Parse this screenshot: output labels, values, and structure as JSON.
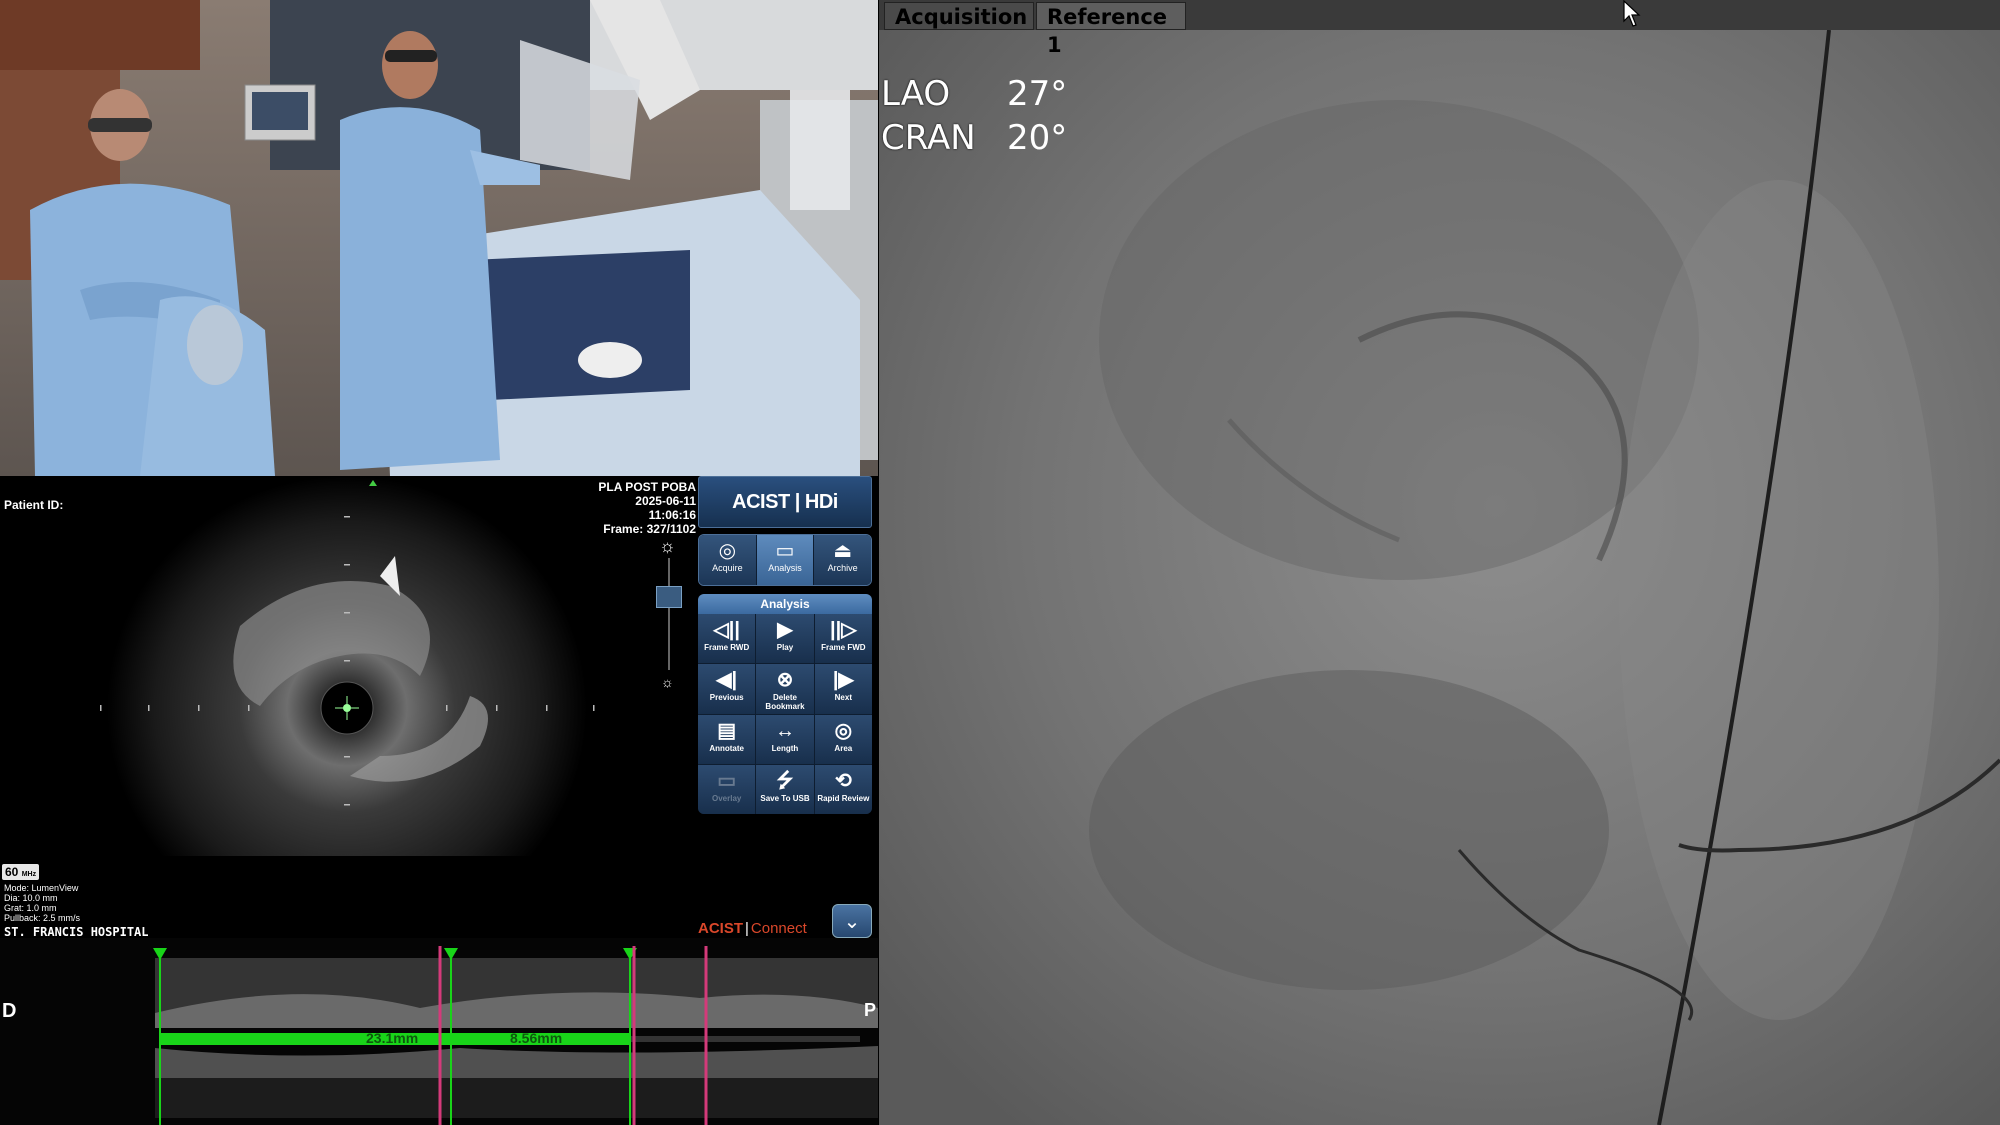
{
  "ivus": {
    "patient_label": "Patient ID:",
    "recording": {
      "name": "PLA POST POBA",
      "date": "2025-06-11",
      "time": "11:06:16",
      "frame": "Frame: 327/1102"
    },
    "frequency": "60",
    "frequency_unit": "MHz",
    "settings": {
      "mode": "Mode: LumenView",
      "dia": "Dia: 10.0 mm",
      "grat": "Grat: 1.0 mm",
      "pullback": "Pullback: 2.5 mm/s"
    },
    "hospital": "ST. FRANCIS HOSPITAL",
    "long_view": {
      "distal": "D",
      "proximal": "P",
      "measure_1": "23.1mm",
      "measure_2": "8.56mm"
    }
  },
  "panel": {
    "logo_acist": "ACIST",
    "logo_hdi": "HDi",
    "modes": [
      {
        "label": "Acquire",
        "icon": "acquire-icon"
      },
      {
        "label": "Analysis",
        "icon": "ruler-icon"
      },
      {
        "label": "Archive",
        "icon": "archive-icon"
      }
    ],
    "analysis_title": "Analysis",
    "buttons": [
      {
        "label": "Frame RWD",
        "icon": "frame-rewind-icon",
        "glyph": "◁||"
      },
      {
        "label": "Play",
        "icon": "play-icon",
        "glyph": "▶"
      },
      {
        "label": "Frame FWD",
        "icon": "frame-forward-icon",
        "glyph": "||▷"
      },
      {
        "label": "Previous",
        "icon": "previous-icon",
        "glyph": "◀|"
      },
      {
        "label": "Delete Bookmark",
        "icon": "delete-bookmark-icon",
        "glyph": "⊗"
      },
      {
        "label": "Next",
        "icon": "next-icon",
        "glyph": "|▶"
      },
      {
        "label": "Annotate",
        "icon": "annotate-icon",
        "glyph": "▤"
      },
      {
        "label": "Length",
        "icon": "length-icon",
        "glyph": "↔"
      },
      {
        "label": "Area",
        "icon": "area-icon",
        "glyph": "◎"
      },
      {
        "label": "Overlay",
        "icon": "overlay-icon",
        "glyph": "▭"
      },
      {
        "label": "Save To USB",
        "icon": "usb-icon",
        "glyph": "⭍"
      },
      {
        "label": "Rapid Review",
        "icon": "rapid-review-icon",
        "glyph": "⟲"
      }
    ],
    "connect_acist": "ACIST",
    "connect_word": "Connect"
  },
  "angio": {
    "tabs": [
      "Acquisition",
      "Reference 1"
    ],
    "lao_label": "LAO",
    "lao_value": "27°",
    "cran_label": "CRAN",
    "cran_value": "20°"
  },
  "colors": {
    "measure_green": "#19d419",
    "marker_pink": "#d43a7a",
    "panel_blue": "#2d4b70",
    "connect_orange": "#d9472a"
  }
}
